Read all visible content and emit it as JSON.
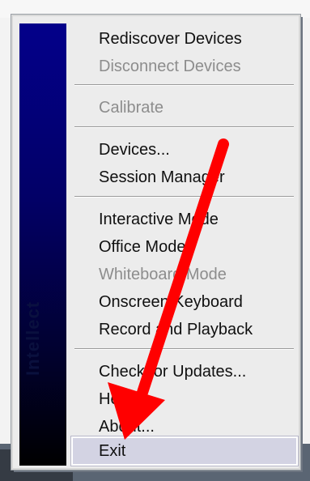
{
  "menu": {
    "banner_text": "Intellect",
    "items": [
      {
        "label": "Rediscover Devices",
        "enabled": true
      },
      {
        "label": "Disconnect Devices",
        "enabled": false
      },
      {
        "label": "Calibrate",
        "enabled": false
      },
      {
        "label": "Devices...",
        "enabled": true
      },
      {
        "label": "Session Manager",
        "enabled": true
      },
      {
        "label": "Interactive Mode",
        "enabled": true
      },
      {
        "label": "Office Mode",
        "enabled": true
      },
      {
        "label": "Whiteboard Mode",
        "enabled": false
      },
      {
        "label": "Onscreen Keyboard",
        "enabled": true
      },
      {
        "label": "Record and Playback",
        "enabled": true
      },
      {
        "label": "Check for Updates...",
        "enabled": true
      },
      {
        "label": "Help",
        "enabled": true
      },
      {
        "label": "About...",
        "enabled": true
      },
      {
        "label": "Exit",
        "enabled": true,
        "highlighted": true
      }
    ]
  },
  "annotation": {
    "arrow_color": "#ff0000"
  }
}
